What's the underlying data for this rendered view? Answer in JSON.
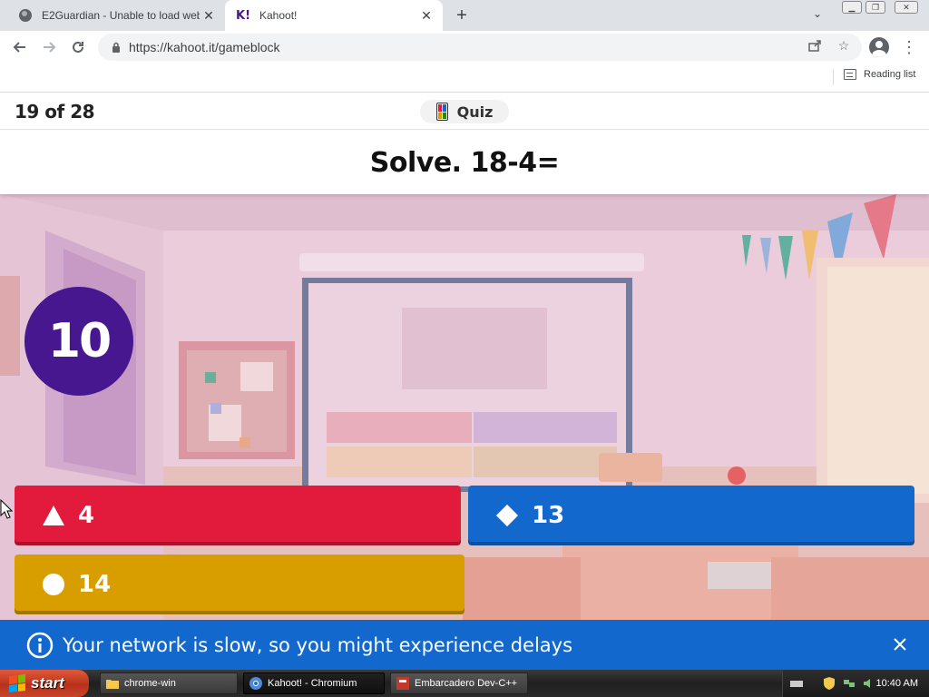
{
  "browser": {
    "tabs": [
      {
        "title": "E2Guardian - Unable to load website",
        "active": false
      },
      {
        "title": "Kahoot!",
        "active": true,
        "favicon": "K!"
      }
    ],
    "url": "https://kahoot.it/gameblock",
    "reading_list": "Reading list"
  },
  "game": {
    "progress": "19 of 28",
    "mode": "Quiz",
    "question": "Solve. 18-4=",
    "timer": "10",
    "answers": [
      {
        "label": "4",
        "shape": "triangle",
        "color": "#e21b3c"
      },
      {
        "label": "13",
        "shape": "diamond",
        "color": "#1368ce"
      },
      {
        "label": "14",
        "shape": "circle",
        "color": "#d89e00"
      }
    ]
  },
  "notice": {
    "text": "Your network is slow, so you might experience delays"
  },
  "taskbar": {
    "start": "start",
    "tasks": [
      "chrome-win",
      "Kahoot! - Chromium",
      "Embarcadero Dev-C++"
    ],
    "clock": "10:40 AM"
  },
  "colors": {
    "kahoot_purple": "#46178f",
    "answer_red": "#e21b3c",
    "answer_blue": "#1368ce",
    "answer_yellow": "#d89e00",
    "banner_blue": "#1368ce"
  }
}
